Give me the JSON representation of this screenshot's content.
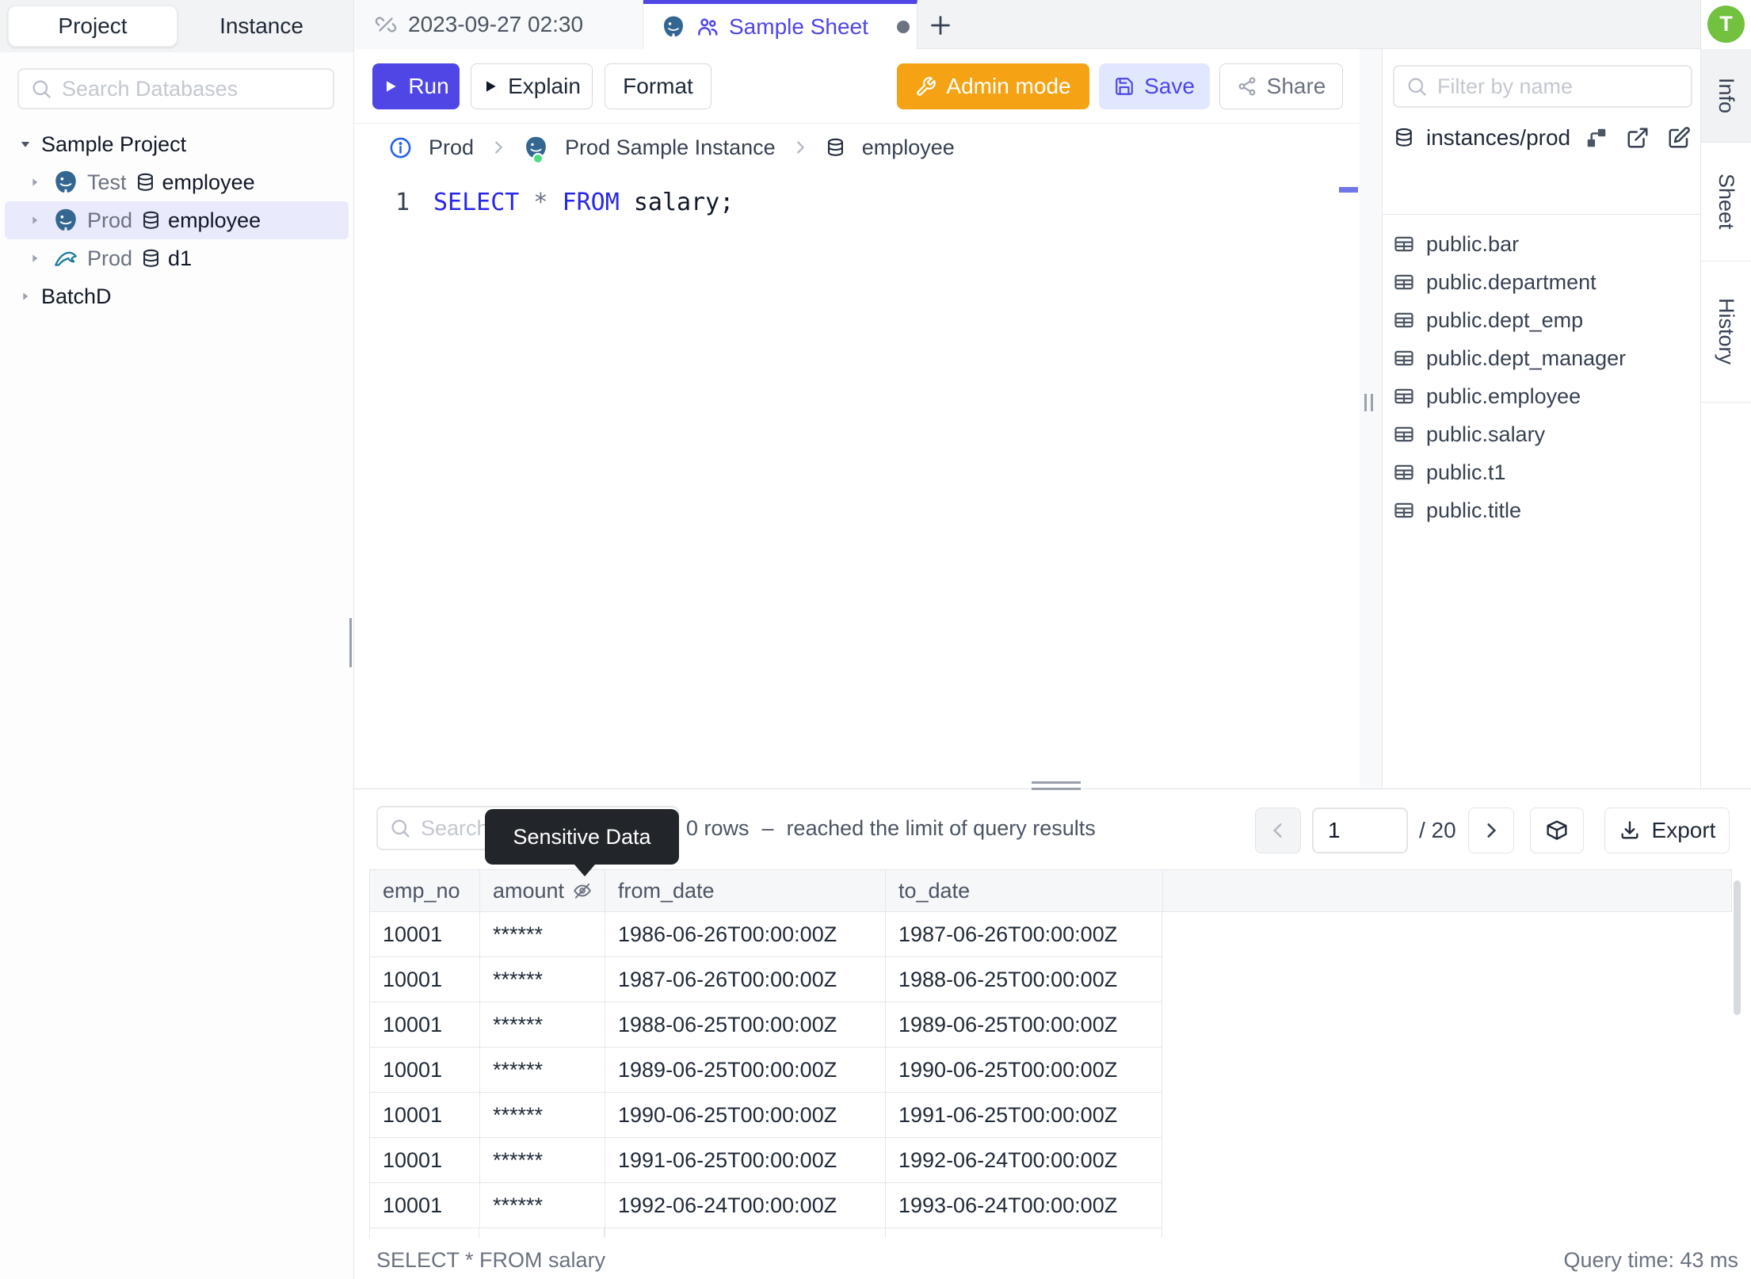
{
  "sidebar": {
    "tabs": [
      "Project",
      "Instance"
    ],
    "search_placeholder": "Search Databases",
    "tree": [
      {
        "label": "Sample Project"
      },
      {
        "engine": "postgres",
        "env": "Test",
        "db": "employee"
      },
      {
        "engine": "postgres",
        "env": "Prod",
        "db": "employee",
        "selected": true
      },
      {
        "engine": "mysql",
        "env": "Prod",
        "db": "d1"
      },
      {
        "label": "BatchD"
      }
    ]
  },
  "tabbar": {
    "tabs": [
      {
        "label": "2023-09-27 02:30"
      },
      {
        "label": "Sample Sheet"
      }
    ],
    "new_tab": "+"
  },
  "toolbar": {
    "run": "Run",
    "explain": "Explain",
    "format": "Format",
    "admin_mode": "Admin mode",
    "save": "Save",
    "share": "Share"
  },
  "breadcrumb": {
    "environment": "Prod",
    "instance": "Prod Sample Instance",
    "database": "employee"
  },
  "editor": {
    "line_number": "1",
    "kw_select": "SELECT",
    "operator": " * ",
    "kw_from": "FROM",
    "rest": " salary;"
  },
  "schema_panel": {
    "filter_placeholder": "Filter by name",
    "source": "instances/prod",
    "tables": [
      "public.bar",
      "public.department",
      "public.dept_emp",
      "public.dept_manager",
      "public.employee",
      "public.salary",
      "public.t1",
      "public.title"
    ]
  },
  "rail": {
    "avatar": "T",
    "tabs": [
      "Info",
      "Sheet",
      "History"
    ]
  },
  "results": {
    "search_placeholder": "Search",
    "tooltip": "Sensitive Data",
    "row_count": "0 rows",
    "separator": "–",
    "limit_message": "reached the limit of query results",
    "page": "1",
    "page_total": "/ 20",
    "export_label": "Export",
    "columns": [
      "emp_no",
      "amount",
      "from_date",
      "to_date"
    ],
    "rows": [
      {
        "emp_no": "10001",
        "amount": "******",
        "from_date": "1986-06-26T00:00:00Z",
        "to_date": "1987-06-26T00:00:00Z"
      },
      {
        "emp_no": "10001",
        "amount": "******",
        "from_date": "1987-06-26T00:00:00Z",
        "to_date": "1988-06-25T00:00:00Z"
      },
      {
        "emp_no": "10001",
        "amount": "******",
        "from_date": "1988-06-25T00:00:00Z",
        "to_date": "1989-06-25T00:00:00Z"
      },
      {
        "emp_no": "10001",
        "amount": "******",
        "from_date": "1989-06-25T00:00:00Z",
        "to_date": "1990-06-25T00:00:00Z"
      },
      {
        "emp_no": "10001",
        "amount": "******",
        "from_date": "1990-06-25T00:00:00Z",
        "to_date": "1991-06-25T00:00:00Z"
      },
      {
        "emp_no": "10001",
        "amount": "******",
        "from_date": "1991-06-25T00:00:00Z",
        "to_date": "1992-06-24T00:00:00Z"
      },
      {
        "emp_no": "10001",
        "amount": "******",
        "from_date": "1992-06-24T00:00:00Z",
        "to_date": "1993-06-24T00:00:00Z"
      }
    ],
    "status_query": "SELECT * FROM salary",
    "query_time": "Query time: 43 ms"
  },
  "colors": {
    "accent_indigo": "#4f46e5",
    "admin_orange": "#f5a314",
    "save_bg": "#e0e7ff",
    "selected_row_bg": "#e9eafb",
    "avatar_green": "#72c13f",
    "tooltip_bg": "#22252a",
    "keyword_blue": "#2727e8"
  }
}
